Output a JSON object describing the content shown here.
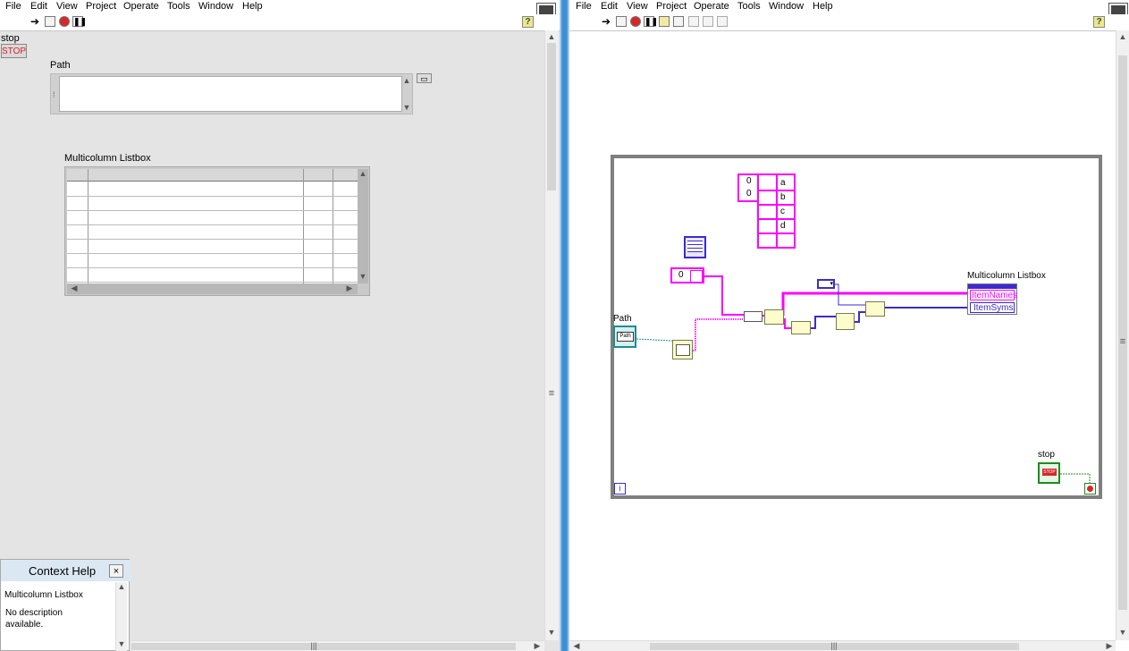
{
  "menus": [
    "File",
    "Edit",
    "View",
    "Project",
    "Operate",
    "Tools",
    "Window",
    "Help"
  ],
  "front_panel": {
    "stop_label": "stop",
    "stop_button_text": "STOP",
    "path_label": "Path",
    "path_value": "",
    "listbox_label": "Multicolumn Listbox",
    "listbox_rows": 8
  },
  "context_help": {
    "title": "Context Help",
    "close": "×",
    "item": "Multicolumn Listbox",
    "description": "No description available."
  },
  "block_diagram": {
    "array_const_index": [
      "0",
      "0"
    ],
    "array_const_values": [
      "a",
      "b",
      "c",
      "d"
    ],
    "numeric_const": "0",
    "path_terminal_label": "Path",
    "path_terminal_text": "Path",
    "listbox_node_label": "Multicolumn Listbox",
    "property_items": [
      "ItemNames",
      "ItemSyms"
    ],
    "stop_terminal_label": "stop",
    "stop_terminal_text": "STOP",
    "loop_iteration": "i",
    "wire_colors": {
      "string": "#ff00ff",
      "numeric": "#3b2bd0",
      "path": "#1e8c8c",
      "bool": "#1f8a1f"
    }
  },
  "colors": {
    "panel_bg": "#e4e4e4",
    "diagram_bg": "#ffffff",
    "divider": "#3d8fd6"
  }
}
